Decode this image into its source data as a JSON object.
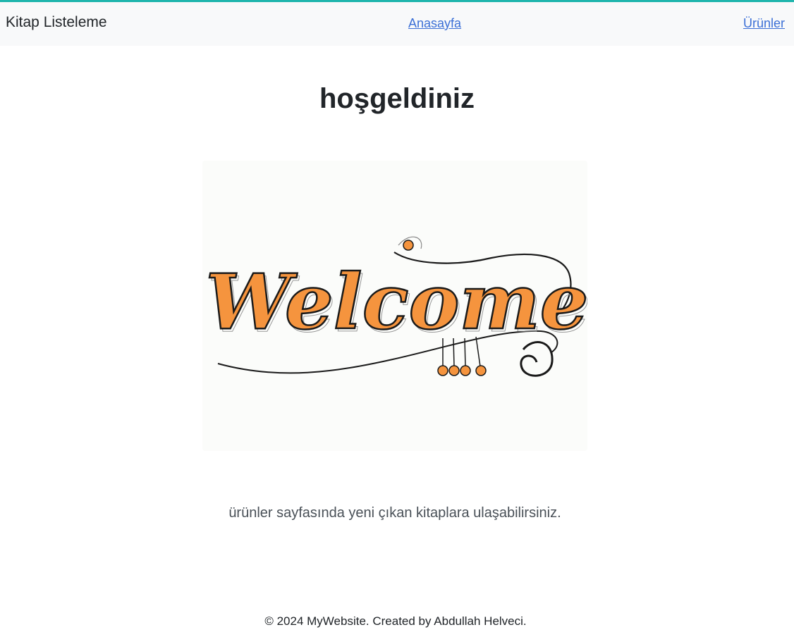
{
  "navbar": {
    "brand": "Kitap Listeleme",
    "links": [
      {
        "label": "Anasayfa"
      },
      {
        "label": "Ürünler"
      }
    ]
  },
  "main": {
    "title": "hoşgeldiniz",
    "image": {
      "lettering": "Welcome"
    },
    "lead": "ürünler sayfasında yeni çıkan kitaplara ulaşabilirsiniz."
  },
  "footer": {
    "text": "© 2024 MyWebsite. Created by Abdullah Helveci."
  },
  "colors": {
    "accent": "#1fb5ad",
    "link": "#3b6fd6",
    "navbar_bg": "#f8f9fa",
    "welcome_fill": "#f5943e"
  }
}
